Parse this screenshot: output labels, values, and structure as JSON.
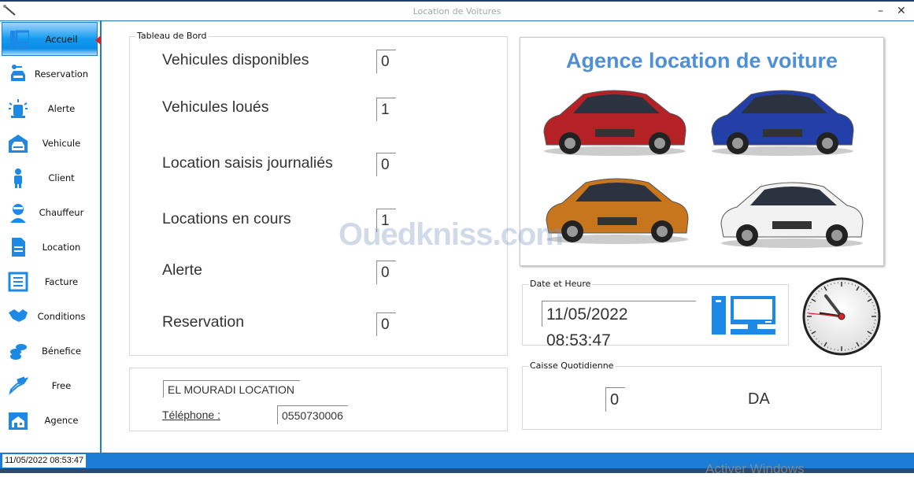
{
  "window": {
    "title": "Location de Voitures",
    "min_label": "–",
    "close_label": "✕"
  },
  "sidebar": {
    "accent": "#1a7cd4",
    "items": [
      {
        "label": "Accueil",
        "icon": "computer-icon",
        "active": true
      },
      {
        "label": "Reservation",
        "icon": "car-key-icon"
      },
      {
        "label": "Alerte",
        "icon": "siren-icon"
      },
      {
        "label": "Vehicule",
        "icon": "garage-car-icon"
      },
      {
        "label": "Client",
        "icon": "person-icon"
      },
      {
        "label": "Chauffeur",
        "icon": "driver-icon"
      },
      {
        "label": "Location",
        "icon": "document-icon"
      },
      {
        "label": "Facture",
        "icon": "invoice-icon"
      },
      {
        "label": "Conditions",
        "icon": "handshake-icon"
      },
      {
        "label": "Bénefice",
        "icon": "coins-icon"
      },
      {
        "label": "Free",
        "icon": "hand-money-icon"
      },
      {
        "label": "Agence",
        "icon": "agency-house-icon"
      }
    ]
  },
  "dashboard": {
    "legend": "Tableau de Bord",
    "stats": [
      {
        "label": "Vehicules disponibles",
        "value": "0"
      },
      {
        "label": "Vehicules loués",
        "value": "1"
      },
      {
        "label": "Location saisis journaliés",
        "value": "0"
      },
      {
        "label": "Locations en cours",
        "value": "1"
      },
      {
        "label": "Alerte",
        "value": "0"
      },
      {
        "label": "Reservation",
        "value": "0"
      }
    ]
  },
  "agency_info": {
    "name": "EL MOURADI LOCATION",
    "phone_label": "Téléphone :",
    "phone": "0550730006"
  },
  "banner": {
    "title": "Agence location de voiture",
    "cars": [
      "red sedan",
      "blue hatchback",
      "orange crossover",
      "white city car"
    ]
  },
  "datetime": {
    "legend": "Date et Heure",
    "value": "11/05/2022 08:53:47"
  },
  "caisse": {
    "legend": "Caisse Quotidienne",
    "value": "0",
    "currency": "DA"
  },
  "status": {
    "datetime": "11/05/2022 08:53:47"
  },
  "watermark": "Ouedkniss.com",
  "activation_notice": "Activer Windows"
}
